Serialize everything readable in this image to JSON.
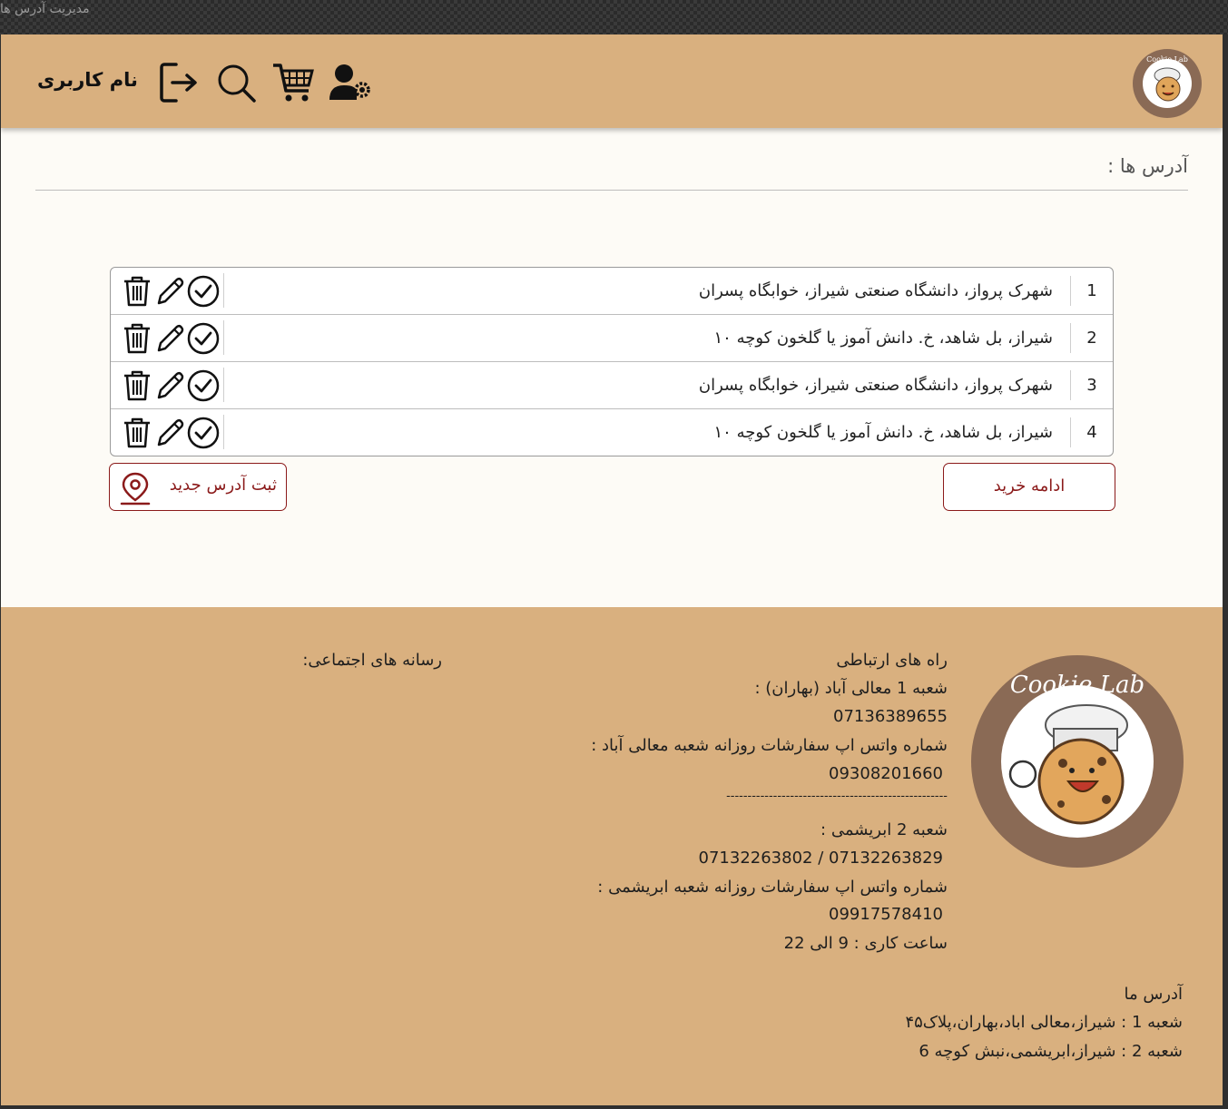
{
  "window": {
    "title": "مدیریت آدرس ها"
  },
  "header": {
    "username": "نام کاربری",
    "icons": [
      "logout-icon",
      "search-icon",
      "cart-icon",
      "user-settings-icon"
    ],
    "logo_text": "Cookie Lab"
  },
  "page": {
    "section_title": "آدرس ها :"
  },
  "addresses": [
    {
      "num": "1",
      "text": "شهرک پرواز، دانشگاه صنعتی شیراز، خوابگاه پسران"
    },
    {
      "num": "2",
      "text": "شیراز، بل شاهد، خ. دانش آموز یا گلخون کوچه ۱۰"
    },
    {
      "num": "3",
      "text": "شهرک پرواز، دانشگاه صنعتی شیراز، خوابگاه پسران"
    },
    {
      "num": "4",
      "text": "شیراز، بل شاهد، خ. دانش آموز یا گلخون کوچه ۱۰"
    }
  ],
  "buttons": {
    "new_address": "ثبت آدرس جدید",
    "continue": "ادامه خرید"
  },
  "footer": {
    "logo_text": "Cookie Lab",
    "contact_title": "راه های ارتباطی",
    "branch1_title": "شعبه 1 معالی آباد (بهاران) :",
    "branch1_phone": "07136389655",
    "branch1_whatsapp_label": "شماره واتس اپ سفارشات روزانه شعبه معالی آباد :",
    "branch1_whatsapp": "09308201660",
    "separator": "----------------------------------------------------",
    "branch2_title": "شعبه 2 ابریشمی :",
    "branch2_phones": "07132263829 / 07132263802",
    "branch2_whatsapp_label": "شماره واتس اپ سفارشات روزانه شعبه ابریشمی :",
    "branch2_whatsapp": "09917578410",
    "hours": "ساعت کاری : 9 الی 22",
    "social_title": "رسانه های اجتماعی:",
    "our_address_title": "آدرس ما",
    "address1": "شعبه 1 :   شیراز،معالی اباد،بهاران،پلاک۴۵",
    "address2": "شعبه 2 :   شیراز،ابریشمی،نبش کوچه 6"
  },
  "colors": {
    "header_bg": "#d9b07f",
    "accent": "#8b1a1a",
    "logo_brown": "#8a6a55"
  }
}
